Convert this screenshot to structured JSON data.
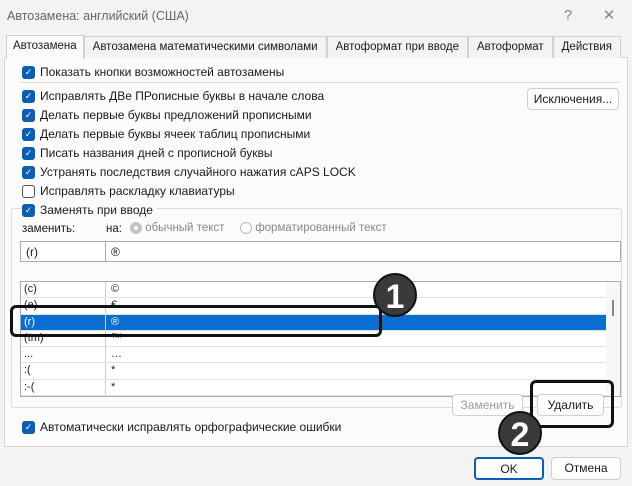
{
  "window": {
    "title": "Автозамена: английский (США)",
    "help": "?",
    "close": "✕"
  },
  "tabs": [
    "Автозамена",
    "Автозамена математическими символами",
    "Автоформат при вводе",
    "Автоформат",
    "Действия"
  ],
  "options": [
    {
      "label": "Показать кнопки возможностей автозамены",
      "checked": true
    },
    {
      "label": "Исправлять ДВе ПРописные буквы в начале слова",
      "checked": true
    },
    {
      "label": "Делать первые буквы предложений прописными",
      "checked": true
    },
    {
      "label": "Делать первые буквы ячеек таблиц прописными",
      "checked": true
    },
    {
      "label": "Писать названия дней с прописной буквы",
      "checked": true
    },
    {
      "label": "Устранять последствия случайного нажатия cAPS LOCK",
      "checked": true
    },
    {
      "label": "Исправлять раскладку клавиатуры",
      "checked": false
    },
    {
      "label": "Заменять при вводе",
      "checked": true
    }
  ],
  "exceptions_button": "Исключения...",
  "replace_label": "заменить:",
  "with_label": "на:",
  "radio_plain": "обычный текст",
  "radio_formatted": "форматированный текст",
  "replace_value": "(r)",
  "with_value": "®",
  "entries": [
    {
      "k": "(c)",
      "v": "©"
    },
    {
      "k": "(e)",
      "v": "€"
    },
    {
      "k": "(r)",
      "v": "®",
      "selected": true
    },
    {
      "k": "(tm)",
      "v": "™"
    },
    {
      "k": "...",
      "v": "…"
    },
    {
      "k": ":(",
      "v": "*"
    },
    {
      "k": ":-(",
      "v": "*"
    }
  ],
  "replace_button": "Заменить",
  "delete_button": "Удалить",
  "spell_option": {
    "label": "Автоматически исправлять орфографические ошибки",
    "checked": true
  },
  "ok_button": "OK",
  "cancel_button": "Отмена",
  "annotations": [
    "1",
    "2"
  ],
  "colors": {
    "accent": "#0a5fb4",
    "selection": "#0a6fd1"
  }
}
